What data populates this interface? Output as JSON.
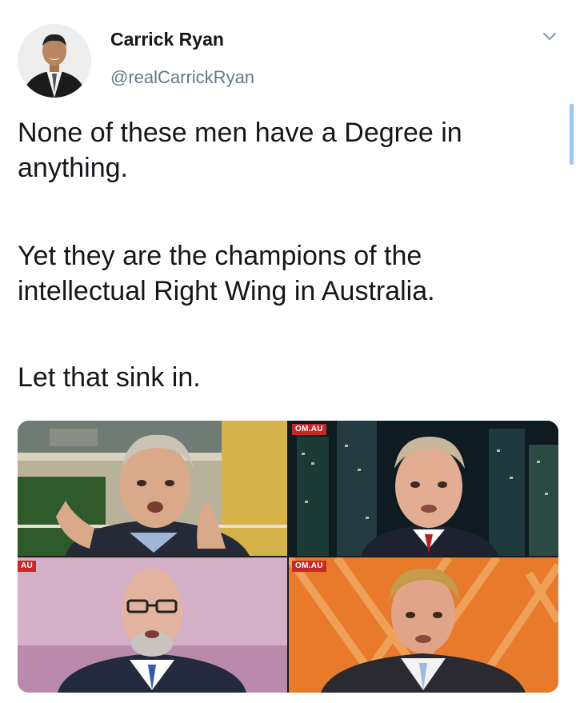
{
  "author": {
    "name": "Carrick Ryan",
    "handle": "@realCarrickRyan",
    "avatar_icon": "profile-photo"
  },
  "menu_icon": "chevron-down-icon",
  "tweet": {
    "paragraphs": [
      "None of these men have a Degree in anything.",
      "Yet they are the champions of the intellectual Right Wing in Australia.",
      "Let that sink in."
    ]
  },
  "media": {
    "watermarks": {
      "top_right": "OM.AU",
      "bottom_left": "AU",
      "bottom_right": "OM.AU"
    }
  },
  "colors": {
    "text": "#14171a",
    "secondary_text": "#657786",
    "accent": "#1da1f2",
    "watermark": "#c62828"
  }
}
